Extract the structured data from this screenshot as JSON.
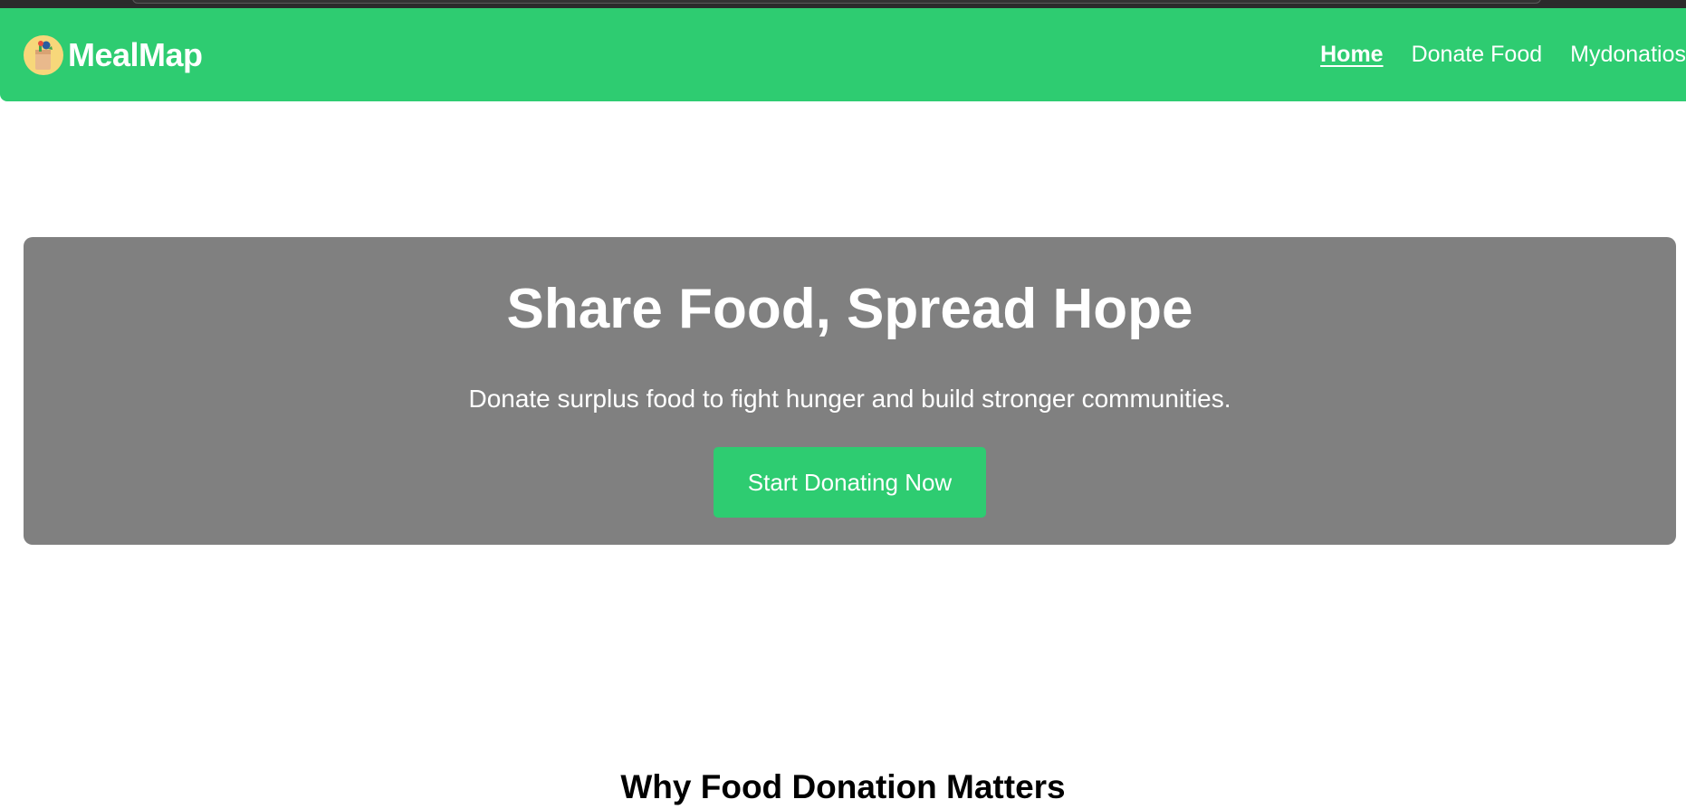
{
  "navbar": {
    "brand_name": "MealMap",
    "logo_icon": "food-bag-icon",
    "links": [
      {
        "label": "Home",
        "active": true
      },
      {
        "label": "Donate Food",
        "active": false
      },
      {
        "label": "Mydonatios",
        "active": false
      }
    ]
  },
  "hero": {
    "title": "Share Food, Spread Hope",
    "subtitle": "Donate surplus food to fight hunger and build stronger communities.",
    "cta_label": "Start Donating Now"
  },
  "sections": {
    "why_title": "Why Food Donation Matters"
  },
  "colors": {
    "brand_green": "#2ecc71",
    "hero_gray": "#808080",
    "text_white": "#ffffff"
  }
}
